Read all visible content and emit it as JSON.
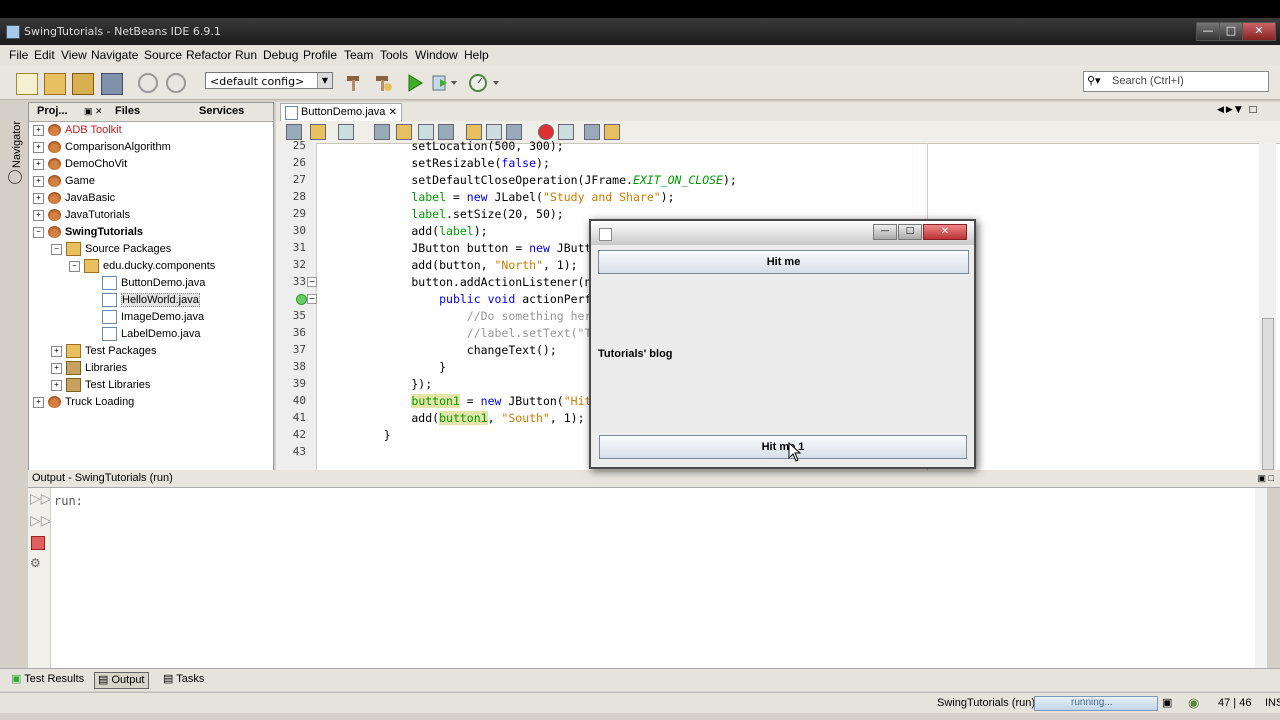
{
  "window": {
    "title": "SwingTutorials - NetBeans IDE 6.9.1"
  },
  "menu": [
    "File",
    "Edit",
    "View",
    "Navigate",
    "Source",
    "Refactor",
    "Run",
    "Debug",
    "Profile",
    "Team",
    "Tools",
    "Window",
    "Help"
  ],
  "toolbar": {
    "config": "<default config>",
    "search_placeholder": "Search (Ctrl+I)"
  },
  "navigator_label": "Navigator",
  "project_tabs": {
    "projects": "Proj...",
    "files": "Files",
    "services": "Services"
  },
  "tree": [
    {
      "label": "ADB Toolkit",
      "type": "project",
      "exp": "+",
      "red": true
    },
    {
      "label": "ComparisonAlgorithm",
      "type": "project",
      "exp": "+"
    },
    {
      "label": "DemoChoVit",
      "type": "project",
      "exp": "+"
    },
    {
      "label": "Game",
      "type": "project",
      "exp": "+"
    },
    {
      "label": "JavaBasic",
      "type": "project",
      "exp": "+"
    },
    {
      "label": "JavaTutorials",
      "type": "project",
      "exp": "+"
    },
    {
      "label": "SwingTutorials",
      "type": "project",
      "exp": "−",
      "bold": true
    },
    {
      "label": "Source Packages",
      "type": "pkg",
      "exp": "−"
    },
    {
      "label": "edu.ducky.components",
      "type": "pkg",
      "exp": "−"
    },
    {
      "label": "ButtonDemo.java",
      "type": "file"
    },
    {
      "label": "HelloWorld.java",
      "type": "file",
      "selected": true
    },
    {
      "label": "ImageDemo.java",
      "type": "file"
    },
    {
      "label": "LabelDemo.java",
      "type": "file"
    },
    {
      "label": "Test Packages",
      "type": "pkg",
      "exp": "+"
    },
    {
      "label": "Libraries",
      "type": "lib",
      "exp": "+"
    },
    {
      "label": "Test Libraries",
      "type": "lib",
      "exp": "+"
    },
    {
      "label": "Truck Loading",
      "type": "project",
      "exp": "+"
    }
  ],
  "editor": {
    "tab": "ButtonDemo.java",
    "lines": [
      {
        "n": "25",
        "code": "        setLocation(500, 300);"
      },
      {
        "n": "26",
        "code": "        setResizable(false);"
      },
      {
        "n": "27",
        "code": "        setDefaultCloseOperation(JFrame.EXIT_ON_CLOSE);"
      },
      {
        "n": "28",
        "code": "        label = new JLabel(\"Study and Share\");"
      },
      {
        "n": "29",
        "code": "        label.setSize(20, 50);"
      },
      {
        "n": "30",
        "code": "        add(label);"
      },
      {
        "n": "31",
        "code": "        JButton button = new JButto"
      },
      {
        "n": "32",
        "code": "        add(button, \"North\", 1);"
      },
      {
        "n": "33",
        "code": "        button.addActionListener(ne"
      },
      {
        "n": "",
        "code": "            public void actionPerfo"
      },
      {
        "n": "35",
        "code": "                //Do something here"
      },
      {
        "n": "36",
        "code": "                //label.setText(\"Tu"
      },
      {
        "n": "37",
        "code": "                changeText();"
      },
      {
        "n": "38",
        "code": "            }"
      },
      {
        "n": "39",
        "code": "        });"
      },
      {
        "n": "40",
        "code": "        button1 = new JButton(\"Hit"
      },
      {
        "n": "41",
        "code": "        add(button1, \"South\", 1);"
      },
      {
        "n": "42",
        "code": "    }"
      },
      {
        "n": "43",
        "code": ""
      }
    ]
  },
  "output": {
    "title": "Output - SwingTutorials (run)",
    "text": "run:"
  },
  "bottom_tabs": [
    "Test Results",
    "Output",
    "Tasks"
  ],
  "status": {
    "task": "SwingTutorials (run)",
    "progress_text": "running...",
    "position": "47 | 46",
    "mode": "INS"
  },
  "swing_app": {
    "top_button": "Hit me",
    "label": "Tutorials' blog",
    "bottom_button": "Hit me 1"
  }
}
